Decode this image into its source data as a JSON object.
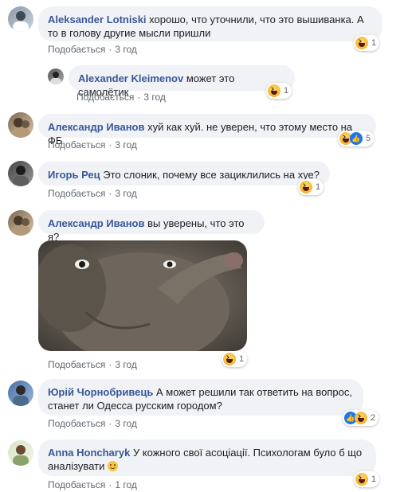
{
  "comments": [
    {
      "author": "Aleksander Lotniski",
      "text_line1": "хорошо, что уточнили, что это вышиванка. А",
      "text_line2": "то в голову другие мысли пришли",
      "like": "Подобається",
      "time": "3 год",
      "reaction_count": "1"
    },
    {
      "author": "Alexander Kleimenov",
      "text": "может это самолётик",
      "like": "Подобається",
      "time": "3 год",
      "reaction_count": "1"
    },
    {
      "author": "Александр Иванов",
      "text": "хуй как хуй. не уверен, что этому место на ФБ",
      "like": "Подобається",
      "time": "3 год",
      "reaction_count": "5"
    },
    {
      "author": "Игорь Рец",
      "text": "Это слоник, почему все зациклились на хуе?",
      "like": "Подобається",
      "time": "3 год",
      "reaction_count": "1"
    },
    {
      "author": "Александр Иванов",
      "text": "вы уверены, что это я?",
      "like": "Подобається",
      "time": "3 год",
      "reaction_count": "1"
    },
    {
      "author": "Юрій Чорнобривець",
      "text_line1": "А может решили так ответить на вопрос,",
      "text_line2": "станет ли Одесса русским городом?",
      "like": "Подобається",
      "time": "3 год",
      "reaction_count": "2"
    },
    {
      "author": "Anna Honcharyk",
      "text_line1": "У кожного свої асоціації. Психологам було б що",
      "text_line2": "аналізувати",
      "like": "Подобається",
      "time": "1 год",
      "reaction_count": "1"
    }
  ],
  "dot": "·",
  "colors": {
    "author": "#385898",
    "bubble": "#f0f2f5",
    "meta": "#606770"
  },
  "icons": [
    "haha-reaction-icon",
    "like-reaction-icon",
    "smile-emoji-icon"
  ]
}
